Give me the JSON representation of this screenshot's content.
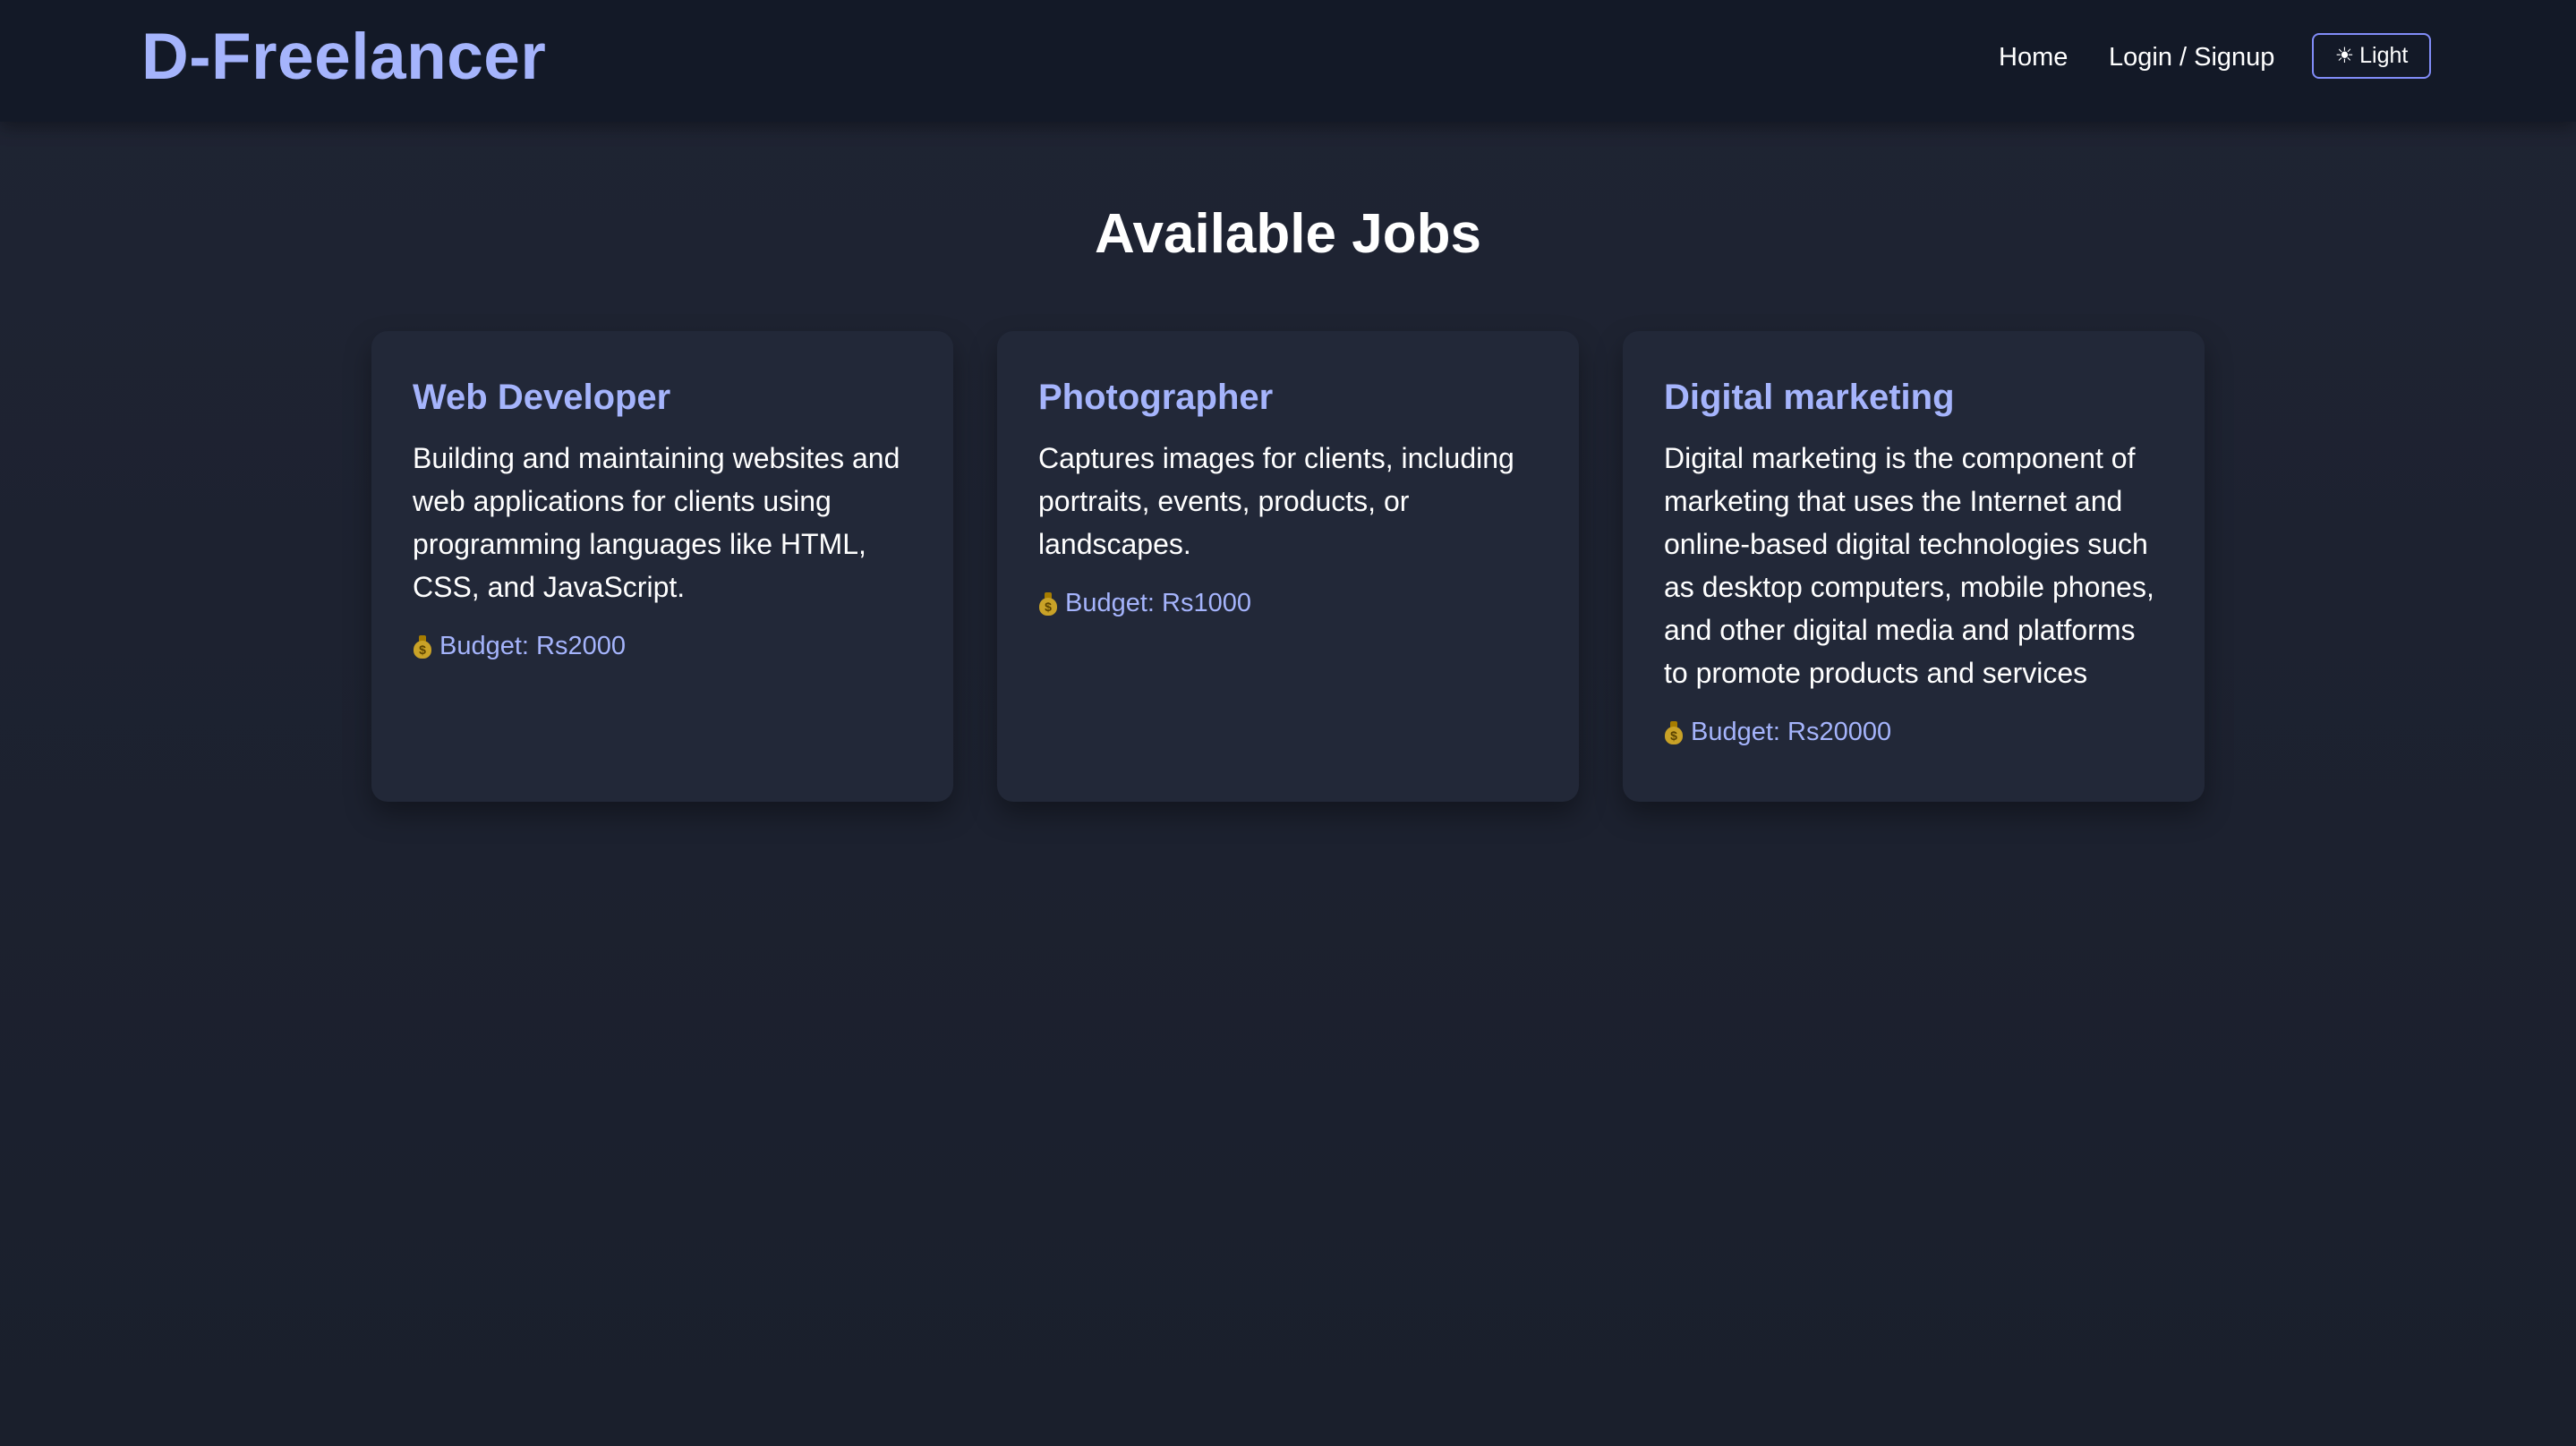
{
  "header": {
    "brand": "D-Freelancer",
    "nav": {
      "home": "Home",
      "login": "Login / Signup"
    },
    "theme_toggle": {
      "icon": "sun-icon",
      "label": "Light"
    }
  },
  "main": {
    "title": "Available Jobs",
    "jobs": [
      {
        "title": "Web Developer",
        "description": "Building and maintaining websites and web applications for clients using programming languages like HTML, CSS, and JavaScript.",
        "budget": "Budget: Rs2000"
      },
      {
        "title": "Photographer",
        "description": "Captures images for clients, including portraits, events, products, or landscapes.",
        "budget": "Budget: Rs1000"
      },
      {
        "title": "Digital marketing",
        "description": "Digital marketing is the component of marketing that uses the Internet and online-based digital technologies such as desktop computers, mobile phones, and other digital media and platforms to promote products and services",
        "budget": "Budget: Rs20000"
      }
    ]
  },
  "colors": {
    "accent": "#a5b4fc",
    "background": "#1f2433",
    "navbar": "#131927",
    "card": "#222838"
  }
}
